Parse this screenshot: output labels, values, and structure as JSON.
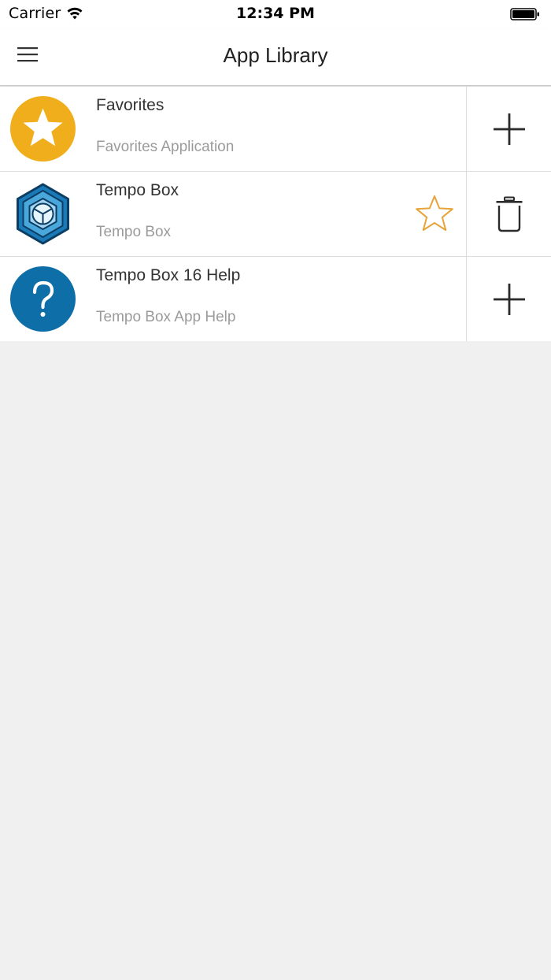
{
  "status_bar": {
    "carrier": "Carrier",
    "time": "12:34 PM"
  },
  "nav": {
    "title": "App Library",
    "menu_icon": "hamburger-menu-icon"
  },
  "apps": [
    {
      "title": "Favorites",
      "subtitle": "Favorites Application",
      "icon": "favorites-star-icon",
      "icon_color": "#f0ae1c",
      "favorited": false,
      "action": "add",
      "action_icon": "plus-icon"
    },
    {
      "title": "Tempo Box",
      "subtitle": "Tempo Box",
      "icon": "tempo-box-cube-icon",
      "icon_color": "#1a7ab8",
      "favorited": true,
      "favorite_icon": "star-outline-icon",
      "action": "delete",
      "action_icon": "trash-icon"
    },
    {
      "title": "Tempo Box 16 Help",
      "subtitle": "Tempo Box App Help",
      "icon": "help-question-icon",
      "icon_color": "#0e6ea8",
      "favorited": false,
      "action": "add",
      "action_icon": "plus-icon"
    }
  ],
  "colors": {
    "accent_star": "#e8a33a",
    "background": "#f0f0f0",
    "divider": "#dcdcdc"
  }
}
